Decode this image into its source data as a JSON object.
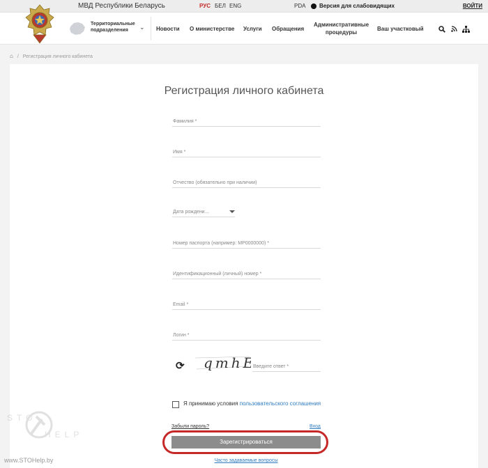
{
  "topbar": {
    "site_title": "МВД Республики Беларусь",
    "languages": [
      "РУС",
      "БЕЛ",
      "ENG"
    ],
    "active_language": "РУС",
    "pda": "PDA",
    "vision_version": "Версия для слабовидящих",
    "login": "ВОЙТИ"
  },
  "header": {
    "region_line1": "Территориальные",
    "region_line2": "подразделения",
    "nav": {
      "news": "Новости",
      "about": "О министерстве",
      "services": "Услуги",
      "appeals": "Обращения",
      "admin_line1": "Административные",
      "admin_line2": "процедуры",
      "officer": "Ваш участковый"
    },
    "icons": [
      "search-icon",
      "rss-icon",
      "sitemap-icon"
    ]
  },
  "breadcrumb": {
    "separator": "/",
    "current": "Регистрация личного кабинета"
  },
  "form": {
    "title": "Регистрация личного кабинета",
    "fields": {
      "surname": "Фамилия *",
      "name": "Имя *",
      "patronymic": "Отчество (обязательно при наличии)",
      "birth_date": "Дата рождени...",
      "passport": "Номер паспорта (например: MP0000000) *",
      "id_number": "Идентификационный (личный) номер *",
      "email": "Email *",
      "login": "Логин *"
    },
    "captcha_text": "qmhE",
    "captcha_placeholder": "Введите ответ *",
    "agree_text": "Я принимаю условия ",
    "agree_link": "пользовательского соглашения",
    "forgot_password": "Забыли пароль?",
    "sign_in": "Вход",
    "submit": "Зарегистрироваться",
    "faq": "Часто задаваемые вопросы"
  },
  "watermark": {
    "url": "www.STOHelp.by"
  },
  "colors": {
    "accent_red": "#c62828",
    "link_blue": "#2e7bbf",
    "button_gray": "#8c8c8c"
  }
}
